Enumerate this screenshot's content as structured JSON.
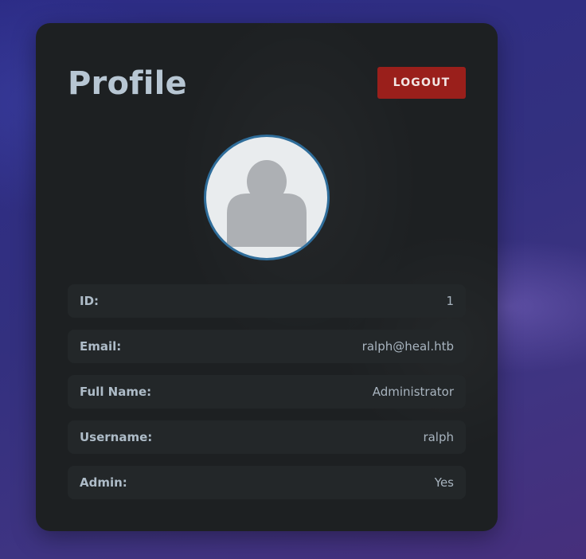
{
  "profile": {
    "title": "Profile",
    "logout_label": "LOGOUT",
    "avatar_icon": "user-silhouette-icon",
    "fields": [
      {
        "label": "ID:",
        "value": "1"
      },
      {
        "label": "Email:",
        "value": "ralph@heal.htb"
      },
      {
        "label": "Full Name:",
        "value": "Administrator"
      },
      {
        "label": "Username:",
        "value": "ralph"
      },
      {
        "label": "Admin:",
        "value": "Yes"
      }
    ]
  },
  "colors": {
    "logout_button": "#9a1f1b",
    "avatar_border": "#2f6d9a",
    "card_background": "#1d2022"
  }
}
